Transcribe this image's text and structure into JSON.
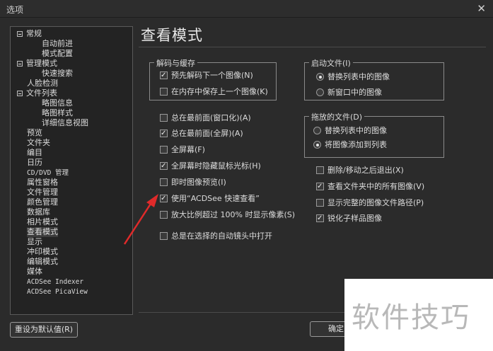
{
  "window": {
    "title": "选项",
    "close_glyph": "✕"
  },
  "tree": [
    {
      "label": "常规",
      "toggle": true
    },
    {
      "label": "自动前进",
      "toggle": false
    },
    {
      "label": "模式配置",
      "toggle": false
    },
    {
      "label": "管理模式",
      "toggle": true
    },
    {
      "label": "快速搜索",
      "toggle": false
    },
    {
      "label": "人脸检测",
      "toggle": false
    },
    {
      "label": "文件列表",
      "toggle": true
    },
    {
      "label": "略图信息",
      "toggle": false
    },
    {
      "label": "略图样式",
      "toggle": false
    },
    {
      "label": "详细信息视图",
      "toggle": false
    },
    {
      "label": "预览",
      "toggle": false
    },
    {
      "label": "文件夹",
      "toggle": false
    },
    {
      "label": "编目",
      "toggle": false
    },
    {
      "label": "日历",
      "toggle": false
    },
    {
      "label": "CD/DVD 管理",
      "toggle": false
    },
    {
      "label": "属性窗格",
      "toggle": false
    },
    {
      "label": "文件管理",
      "toggle": false
    },
    {
      "label": "颜色管理",
      "toggle": false
    },
    {
      "label": "数据库",
      "toggle": false
    },
    {
      "label": "相片模式",
      "toggle": false
    },
    {
      "label": "查看模式",
      "toggle": false
    },
    {
      "label": "显示",
      "toggle": false
    },
    {
      "label": "冲印模式",
      "toggle": false
    },
    {
      "label": "编辑模式",
      "toggle": false
    },
    {
      "label": "媒体",
      "toggle": false
    },
    {
      "label": "ACDSee Indexer",
      "toggle": false
    },
    {
      "label": "ACDSee PicaView",
      "toggle": false
    }
  ],
  "panel": {
    "title": "查看模式",
    "decode_group": {
      "title": "解码与缓存",
      "options": [
        {
          "label": "预先解码下一个图像(N)",
          "checked": true
        },
        {
          "label": "在内存中保存上一个图像(K)",
          "checked": false
        }
      ]
    },
    "startup_group": {
      "title": "启动文件(I)",
      "options": [
        {
          "label": "替换列表中的图像",
          "selected": true
        },
        {
          "label": "新窗口中的图像",
          "selected": false
        }
      ]
    },
    "drop_group": {
      "title": "拖放的文件(D)",
      "options": [
        {
          "label": "替换列表中的图像",
          "selected": false
        },
        {
          "label": "将图像添加到列表",
          "selected": true
        }
      ]
    },
    "left_options": [
      {
        "label": "总在最前面(窗口化)(A)",
        "checked": false
      },
      {
        "label": "总在最前面(全屏)(A)",
        "checked": true
      },
      {
        "label": "全屏幕(F)",
        "checked": false
      },
      {
        "label": "全屏幕时隐藏鼠标光标(H)",
        "checked": true
      },
      {
        "label": "即时图像预览(I)",
        "checked": false
      },
      {
        "label": "使用“ACDSee 快速查看”",
        "checked": true
      },
      {
        "label": "放大比例超过 100% 时显示像素(S)",
        "checked": false
      },
      {
        "label": "总是在选择的自动镜头中打开",
        "checked": false
      }
    ],
    "right_options": [
      {
        "label": "删除/移动之后退出(X)",
        "checked": false
      },
      {
        "label": "查看文件夹中的所有图像(V)",
        "checked": true
      },
      {
        "label": "显示完整的图像文件路径(P)",
        "checked": false
      },
      {
        "label": "锐化子样品图像",
        "checked": true
      }
    ]
  },
  "buttons": {
    "reset": "重设为默认值(R)",
    "ok": "确定"
  },
  "watermark": "软件技巧",
  "colors": {
    "background": "#2b2b2b",
    "arrow": "#e02a2a",
    "watermark_bg": "#ffffff"
  }
}
